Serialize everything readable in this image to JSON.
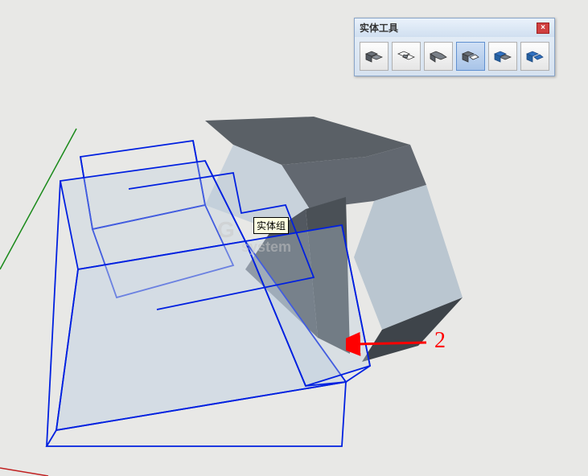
{
  "toolbar": {
    "title": "实体工具",
    "close_label": "×",
    "tools": [
      {
        "name": "outer-shell",
        "active": false
      },
      {
        "name": "intersect",
        "active": false
      },
      {
        "name": "union",
        "active": false
      },
      {
        "name": "subtract",
        "active": true
      },
      {
        "name": "trim",
        "active": false
      },
      {
        "name": "split",
        "active": false
      }
    ]
  },
  "tooltip": {
    "text": "实体组"
  },
  "annotation": {
    "label": "2"
  },
  "watermark": {
    "main": "G",
    "sub": "system"
  }
}
